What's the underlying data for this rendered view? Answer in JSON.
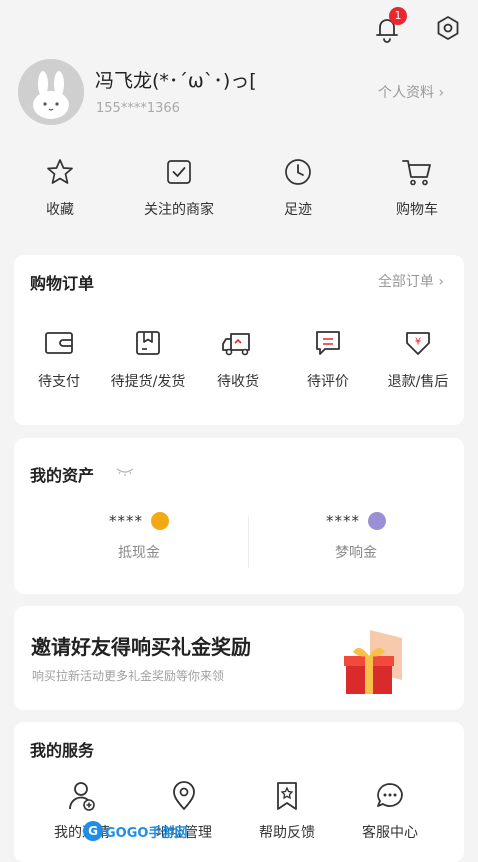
{
  "header": {
    "notification_count": "1",
    "icons": [
      "bell-icon",
      "settings-icon"
    ]
  },
  "profile": {
    "name": "冯飞龙(*･´ω`･)っ[",
    "phone": "155****1366",
    "profile_link": "个人资料 ›"
  },
  "quick_actions": [
    {
      "label": "收藏",
      "icon": "star-icon"
    },
    {
      "label": "关注的商家",
      "icon": "checkbox-icon"
    },
    {
      "label": "足迹",
      "icon": "clock-icon"
    },
    {
      "label": "购物车",
      "icon": "cart-icon"
    }
  ],
  "orders": {
    "title": "购物订单",
    "all_label": "全部订单 ›",
    "items": [
      {
        "label": "待支付",
        "icon": "wallet-icon"
      },
      {
        "label": "待提货/发货",
        "icon": "package-icon"
      },
      {
        "label": "待收货",
        "icon": "truck-icon"
      },
      {
        "label": "待评价",
        "icon": "comment-icon"
      },
      {
        "label": "退款/售后",
        "icon": "refund-icon"
      }
    ]
  },
  "assets": {
    "title": "我的资产",
    "items": [
      {
        "value": "****",
        "label": "抵现金",
        "coin_color": "#f3a916"
      },
      {
        "value": "****",
        "label": "梦响金",
        "coin_color": "#9b8fd6"
      }
    ]
  },
  "promo": {
    "title": "邀请好友得响买礼金奖励",
    "subtitle": "响买拉新活动更多礼金奖励等你来领"
  },
  "services": {
    "title": "我的服务",
    "items": [
      {
        "label": "我的邀请",
        "icon": "user-add-icon"
      },
      {
        "label": "地址管理",
        "icon": "location-icon"
      },
      {
        "label": "帮助反馈",
        "icon": "bookmark-icon"
      },
      {
        "label": "客服中心",
        "icon": "chat-icon"
      }
    ]
  },
  "watermark": {
    "text": "GOGO手游网"
  }
}
